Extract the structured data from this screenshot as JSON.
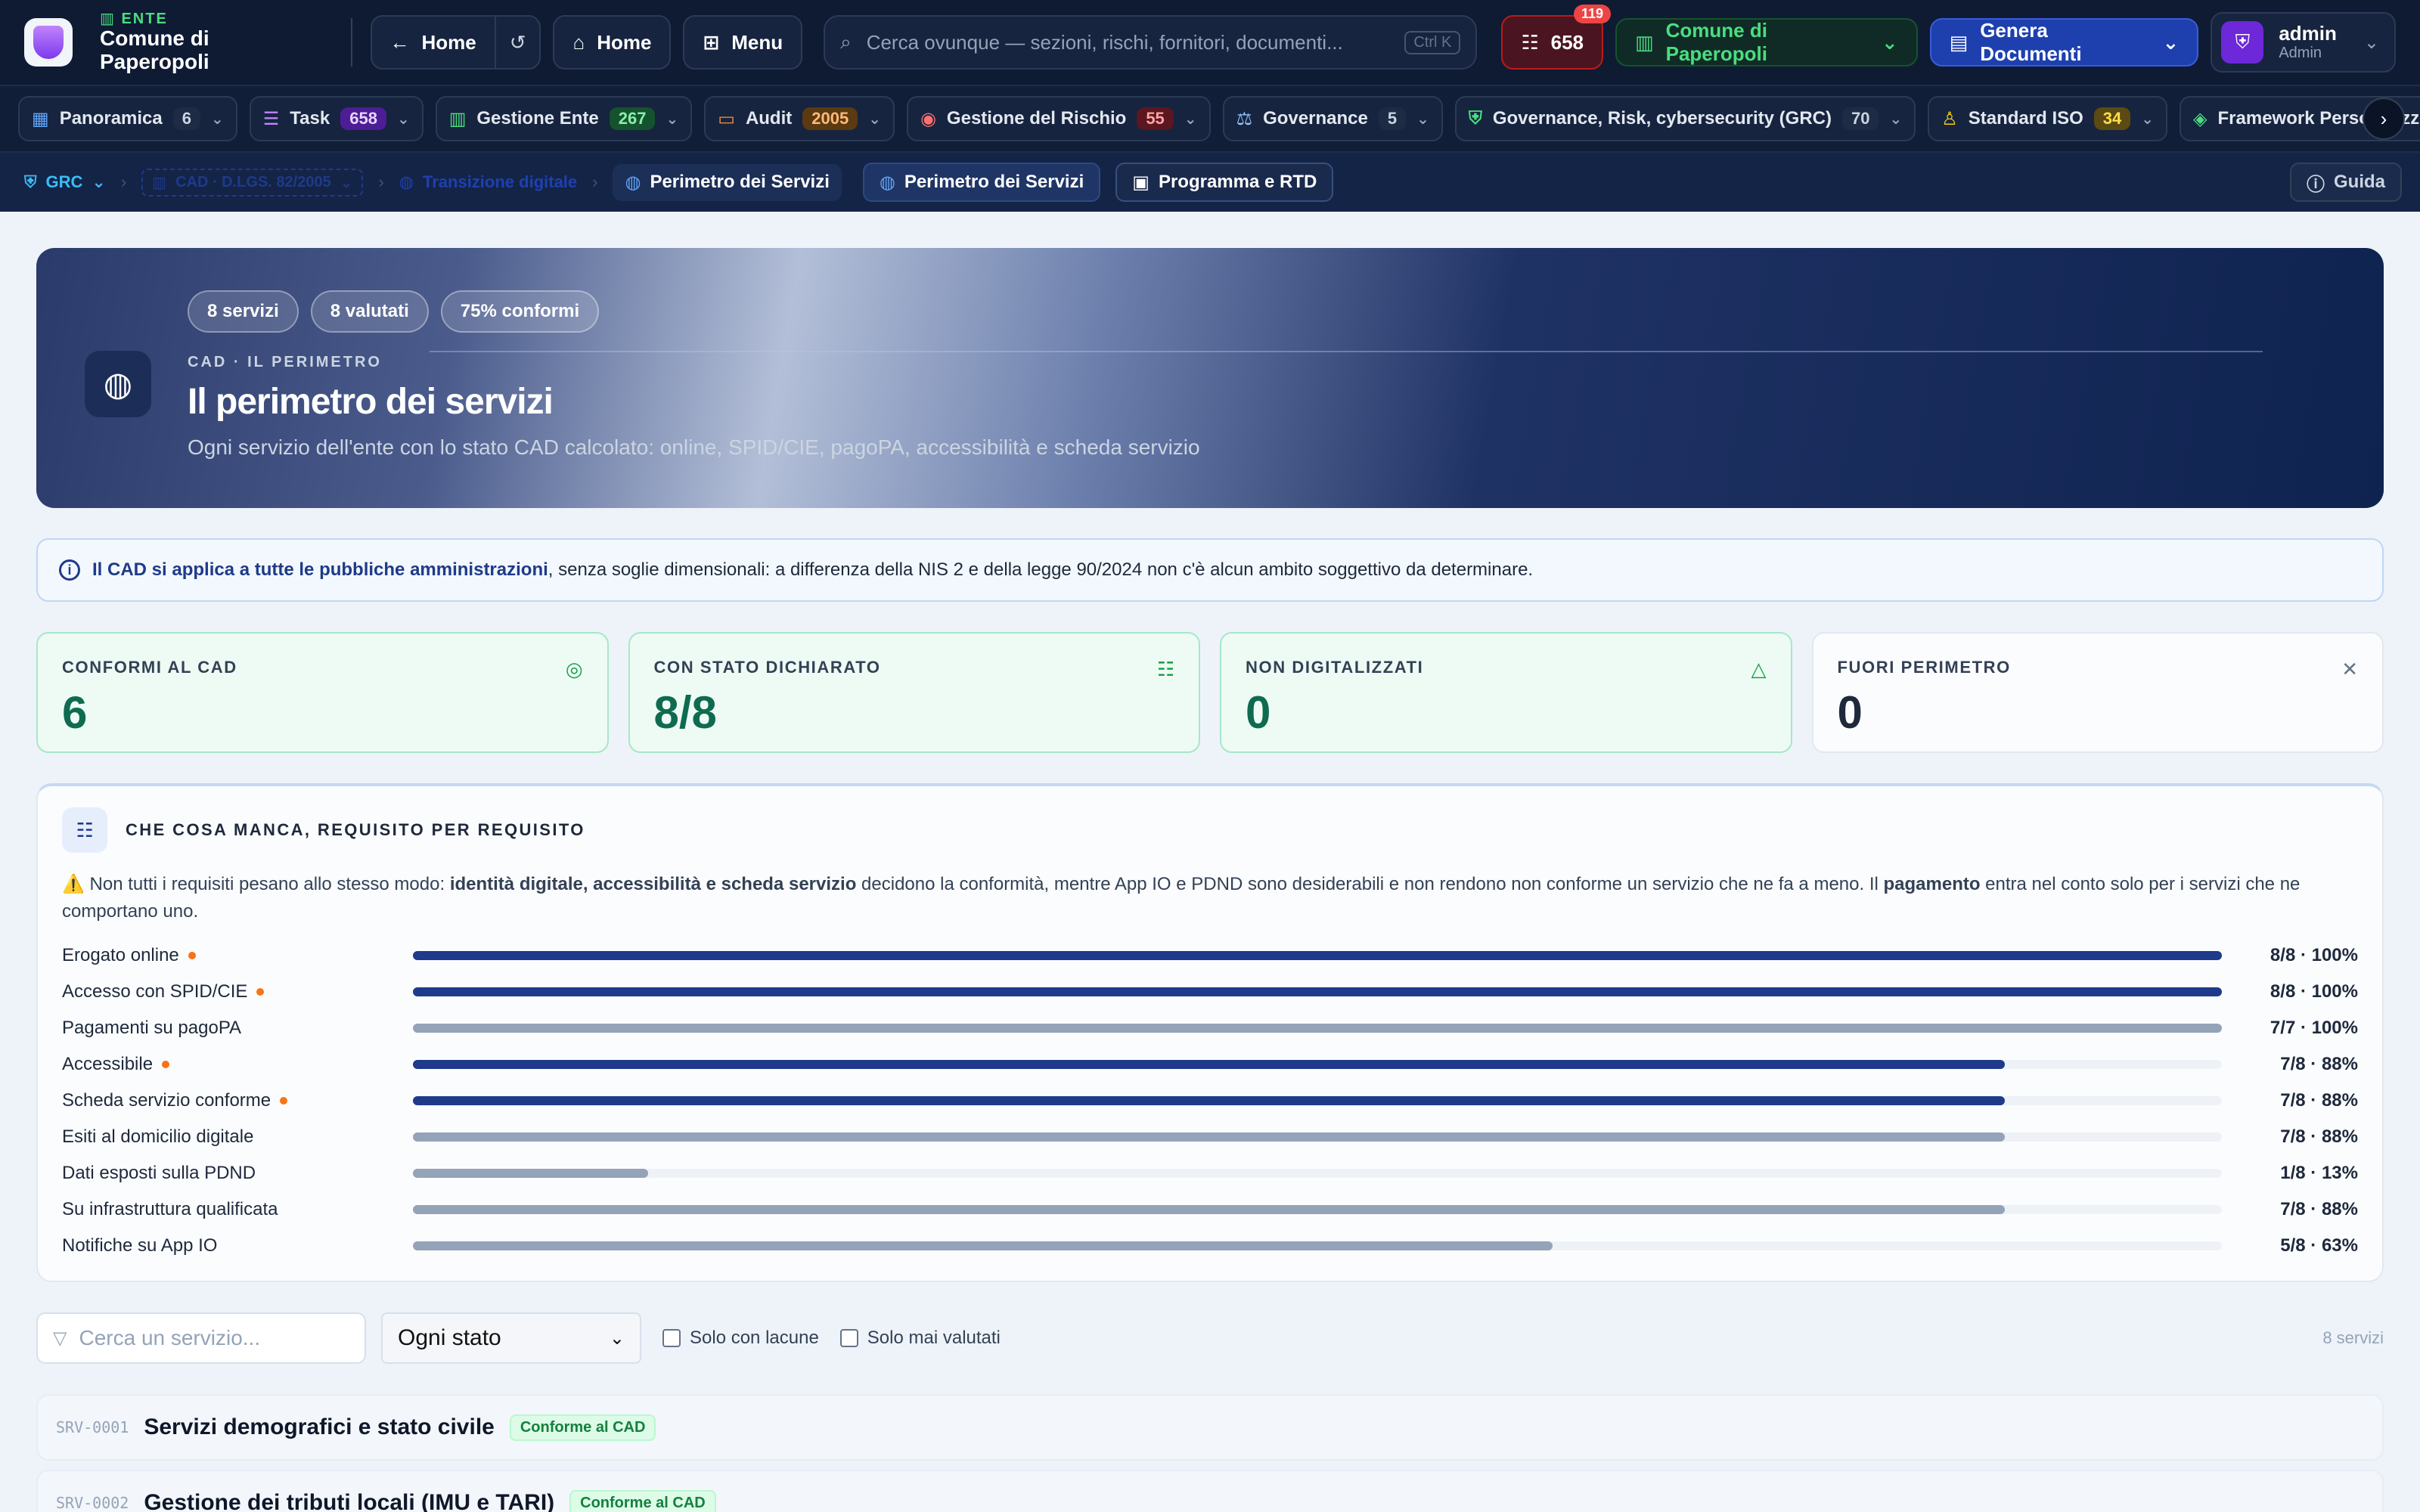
{
  "app": {
    "ente_tag": "ENTE",
    "ente_name": "Comune di Paperopoli"
  },
  "topbar": {
    "back_label": "Home",
    "home_label": "Home",
    "menu_label": "Menu",
    "search_placeholder": "Cerca ovunque — sezioni, rischi, fornitori, documenti...",
    "search_shortcut": "Ctrl K",
    "task_count": "658",
    "task_notif": "119",
    "ente_selector": "Comune di Paperopoli",
    "generate_label": "Genera Documenti",
    "user_name": "admin",
    "user_role": "Admin"
  },
  "modules": [
    {
      "label": "Panoramica",
      "count": "6",
      "cbg": "#1e2b45",
      "cfg": "#cbd5e1",
      "icon": "▦",
      "icolor": "#60a5fa"
    },
    {
      "label": "Task",
      "count": "658",
      "cbg": "#4c1d95",
      "cfg": "#e9d5ff",
      "icon": "☰",
      "icolor": "#c084fc"
    },
    {
      "label": "Gestione Ente",
      "count": "267",
      "cbg": "#14532d",
      "cfg": "#86efac",
      "icon": "▥",
      "icolor": "#4ade80"
    },
    {
      "label": "Audit",
      "count": "2005",
      "cbg": "#5b3a12",
      "cfg": "#fdba74",
      "icon": "▭",
      "icolor": "#fb923c"
    },
    {
      "label": "Gestione del Rischio",
      "count": "55",
      "cbg": "#5b1620",
      "cfg": "#fca5a5",
      "icon": "◉",
      "icolor": "#f87171"
    },
    {
      "label": "Governance",
      "count": "5",
      "cbg": "#1e2b45",
      "cfg": "#cbd5e1",
      "icon": "⚖",
      "icolor": "#93c5fd"
    },
    {
      "label": "Governance, Risk, cybersecurity (GRC)",
      "count": "70",
      "cbg": "#1e2b45",
      "cfg": "#cbd5e1",
      "icon": "⛨",
      "icolor": "#4ade80"
    },
    {
      "label": "Standard ISO",
      "count": "34",
      "cbg": "#5b4a12",
      "cfg": "#fde047",
      "icon": "♙",
      "icolor": "#facc15"
    },
    {
      "label": "Framework Personalizzati",
      "count": "",
      "cbg": "#1e2b45",
      "cfg": "#cbd5e1",
      "icon": "◈",
      "icolor": "#4ade80"
    }
  ],
  "breadcrumb": {
    "grc": "GRC",
    "cad": "CAD · D.LGS. 82/2005",
    "transizione": "Transizione digitale",
    "current": "Perimetro dei Servizi"
  },
  "subtabs": {
    "perimetro": "Perimetro dei Servizi",
    "programma": "Programma e RTD",
    "guida": "Guida"
  },
  "hero": {
    "pills": [
      "8 servizi",
      "8 valutati",
      "75% conformi"
    ],
    "kicker": "CAD · IL PERIMETRO",
    "title": "Il perimetro dei servizi",
    "subtitle": "Ogni servizio dell'ente con lo stato CAD calcolato: online, SPID/CIE, pagoPA, accessibilità e scheda servizio"
  },
  "info": {
    "bold": "Il CAD si applica a tutte le pubbliche amministrazioni",
    "rest": ", senza soglie dimensionali: a differenza della NIS 2 e della legge 90/2024 non c'è alcun ambito soggettivo da determinare."
  },
  "kpis": [
    {
      "label": "CONFORMI AL CAD",
      "value": "6",
      "icon": "◎"
    },
    {
      "label": "CON STATO DICHIARATO",
      "value": "8/8",
      "icon": "☷"
    },
    {
      "label": "NON DIGITALIZZATI",
      "value": "0",
      "icon": "△"
    },
    {
      "label": "FUORI PERIMETRO",
      "value": "0",
      "icon": "✕"
    }
  ],
  "requirements": {
    "title": "CHE COSA MANCA, REQUISITO PER REQUISITO",
    "note_prefix": "⚠️ Non tutti i requisiti pesano allo stesso modo: ",
    "note_bold1": "identità digitale, accessibilità e scheda servizio",
    "note_mid": " decidono la conformità, mentre App IO e PDND sono desiderabili e non rendono non conforme un servizio che ne fa a meno. Il ",
    "note_bold2": "pagamento",
    "note_end": " entra nel conto solo per i servizi che ne comportano uno.",
    "items": [
      {
        "label": "Erogato online",
        "core": true,
        "fraction": 1.0,
        "value": "8/8 · 100%"
      },
      {
        "label": "Accesso con SPID/CIE",
        "core": true,
        "fraction": 1.0,
        "value": "8/8 · 100%"
      },
      {
        "label": "Pagamenti su pagoPA",
        "core": false,
        "fraction": 1.0,
        "value": "7/7 · 100%"
      },
      {
        "label": "Accessibile",
        "core": true,
        "fraction": 0.88,
        "value": "7/8 · 88%"
      },
      {
        "label": "Scheda servizio conforme",
        "core": true,
        "fraction": 0.88,
        "value": "7/8 · 88%"
      },
      {
        "label": "Esiti al domicilio digitale",
        "core": false,
        "fraction": 0.88,
        "value": "7/8 · 88%"
      },
      {
        "label": "Dati esposti sulla PDND",
        "core": false,
        "fraction": 0.13,
        "value": "1/8 · 13%"
      },
      {
        "label": "Su infrastruttura qualificata",
        "core": false,
        "fraction": 0.88,
        "value": "7/8 · 88%"
      },
      {
        "label": "Notifiche su App IO",
        "core": false,
        "fraction": 0.63,
        "value": "5/8 · 63%"
      }
    ]
  },
  "filters": {
    "search_placeholder": "Cerca un servizio...",
    "status_value": "Ogni stato",
    "only_gaps": "Solo con lacune",
    "never_evaluated": "Solo mai valutati",
    "count": "8 servizi"
  },
  "services": [
    {
      "code": "SRV-0001",
      "name": "Servizi demografici e stato civile",
      "badge": "Conforme al CAD"
    },
    {
      "code": "SRV-0002",
      "name": "Gestione dei tributi locali (IMU e TARI)",
      "badge": "Conforme al CAD"
    }
  ]
}
